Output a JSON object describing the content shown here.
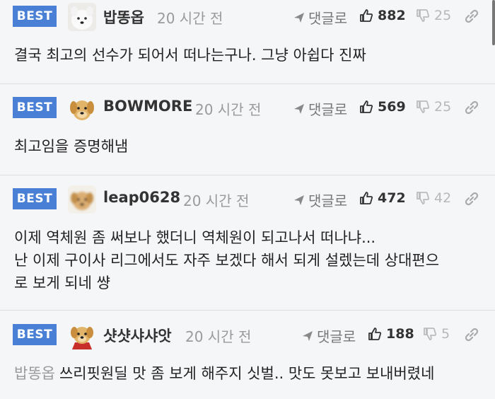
{
  "comments": [
    {
      "badge": "BEST",
      "author": "밥똥옵",
      "time": "20 시간 전",
      "reply_label": "댓글로",
      "upvotes": "882",
      "downvotes": "25",
      "avatar": "white-puppy",
      "text": "결국 최고의 선수가 되어서 떠나는구나. 그냥 아쉽다 진짜"
    },
    {
      "badge": "BEST",
      "author": "BOWMORE",
      "time": "20 시간 전",
      "reply_label": "댓글로",
      "upvotes": "569",
      "downvotes": "25",
      "avatar": "golden-puppy",
      "text": "최고임을 증명해냄"
    },
    {
      "badge": "BEST",
      "author": "leap0628",
      "time": "20 시간 전",
      "reply_label": "댓글로",
      "upvotes": "472",
      "downvotes": "42",
      "avatar": "blurred-puppy",
      "text_lines": [
        "이제 역체원 좀 써보나 했더니 역체원이 되고나서 떠나냐...",
        "난 이제 구이사 리그에서도 자주 보겠다 해서 되게 설렜는데 상대편으",
        "로 보게 되네 썅"
      ]
    },
    {
      "badge": "BEST",
      "author": "샷샷샤샤앗",
      "time": "20 시간 전",
      "reply_label": "댓글로",
      "upvotes": "188",
      "downvotes": "5",
      "avatar": "golden-puppy-red",
      "quote": "밥똥옵",
      "text": "쓰리핏원딜 맛 좀 보게 해주지 싯벌.. 맛도 못보고 보내버렸네"
    }
  ],
  "colors": {
    "best_badge": "#4a7fd6",
    "background": "#f5f6f8",
    "muted": "#9a9a9a"
  }
}
